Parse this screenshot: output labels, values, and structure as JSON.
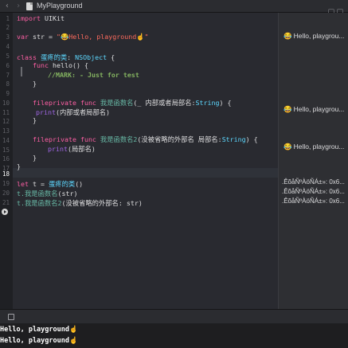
{
  "window": {
    "title": "MyPlayground"
  },
  "gutter": {
    "lines": [
      "1",
      "2",
      "3",
      "4",
      "5",
      "6",
      "7",
      "8",
      "9",
      "10",
      "11",
      "12",
      "13",
      "14",
      "15",
      "16",
      "17",
      "18",
      "19",
      "20",
      "21"
    ],
    "current_line": "18"
  },
  "code": {
    "l1": {
      "kw": "import",
      "rest": " UIKit"
    },
    "l3": {
      "kw": "var",
      "name": " str = ",
      "str": "\"😂Hello, playground☝️\""
    },
    "l5": {
      "kw": "class",
      "name": " 蛋疼的类",
      "sep": ": ",
      "type": "NSObject",
      "rest": " {"
    },
    "l6": {
      "kw": "func",
      "rest": " hello() {"
    },
    "l7": {
      "comment": "//MARK: - Just for test"
    },
    "l8": {
      "rest": "}"
    },
    "l10": {
      "kw1": "fileprivate",
      "kw2": " func",
      "name": " 我是函数名",
      "args": "(_ 内部或者局部名:",
      "type": "String",
      "rest": ") {"
    },
    "l11": {
      "fn": "print",
      "rest": "(内部或者局部名)"
    },
    "l12": {
      "rest": "}"
    },
    "l14": {
      "kw1": "fileprivate",
      "kw2": " func",
      "name": " 我是函数名2",
      "args": "(没被省略的外部名 局部名:",
      "type": "String",
      "rest": ") {"
    },
    "l15": {
      "fn": "print",
      "rest": "(局部名)"
    },
    "l16": {
      "rest": "}"
    },
    "l17": {
      "rest": "}"
    },
    "l19": {
      "kw": "let",
      "rest": " t = ",
      "cls": "蛋疼的类",
      "tail": "()"
    },
    "l20": {
      "a": "t.",
      "b": "我是函数名",
      "c": "(str)"
    },
    "l21": {
      "a": "t.",
      "b": "我是函数名2",
      "c": "(没被省略的外部名: str)"
    }
  },
  "results": {
    "r3": {
      "emoji": "😂",
      "text": "Hello, playgrou..."
    },
    "r11": {
      "emoji": "😂",
      "text": "Hello, playgrou..."
    },
    "r15": {
      "emoji": "😂",
      "text": "Hello, playgrou..."
    },
    "r19": {
      "text": ".ÊõåÑºÀöÑÁ±»: 0x6..."
    },
    "r20": {
      "text": ".ÊõåÑºÀöÑÁ±»: 0x6..."
    },
    "r21": {
      "text": ".ÊõåÑºÀöÑÁ±»: 0x6..."
    }
  },
  "console": {
    "lines": [
      "Hello, playground☝️",
      "Hello, playground☝️"
    ]
  },
  "colors": {
    "keyword": "#fc5fa3",
    "type": "#5dd8ff",
    "string": "#fc6a5d",
    "comment": "#84b360",
    "identifier": "#a167e6",
    "function": "#67b7a4"
  }
}
